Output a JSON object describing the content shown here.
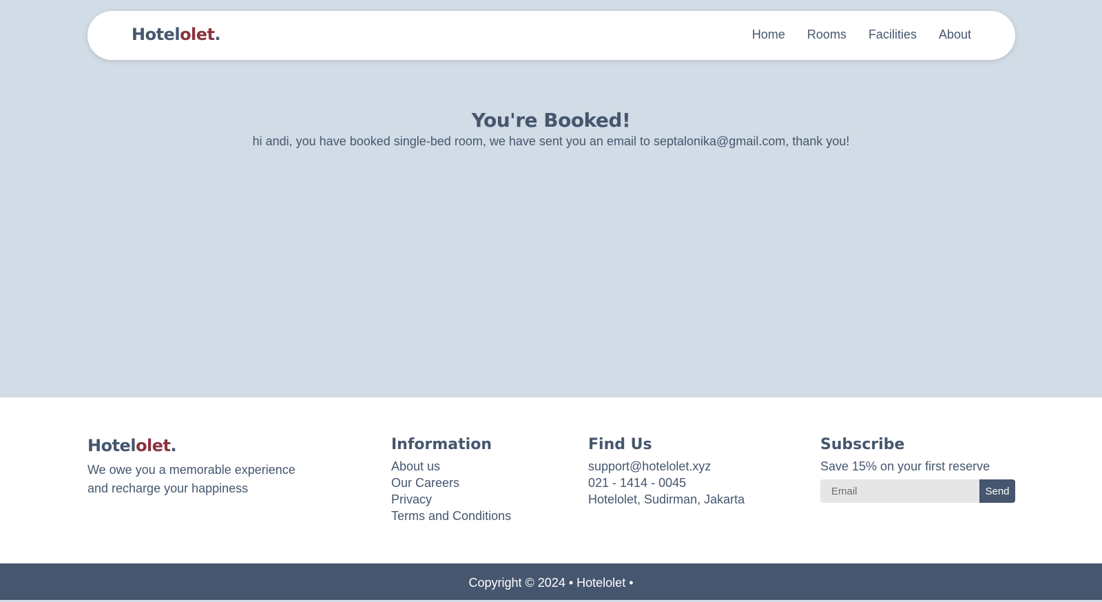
{
  "brand": {
    "name_main": "Hotel",
    "name_accent": "olet",
    "name_dot": ".",
    "colors": {
      "primary": "#45566e",
      "accent": "#8b3340",
      "page_bg": "#d2dce6"
    }
  },
  "nav": {
    "links": [
      "Home",
      "Rooms",
      "Facilities",
      "About"
    ]
  },
  "hero": {
    "title": "You're Booked!",
    "message": "hi andi, you have booked single-bed room, we have sent you an email to septalonika@gmail.com, thank you!"
  },
  "footer": {
    "tagline_line1": "We owe you a memorable experience",
    "tagline_line2": "and recharge your happiness",
    "information": {
      "heading": "Information",
      "links": [
        "About us",
        "Our Careers",
        "Privacy",
        "Terms and Conditions"
      ]
    },
    "find_us": {
      "heading": "Find Us",
      "email": "support@hotelolet.xyz",
      "phone": "021 - 1414 - 0045",
      "address": "Hotelolet, Sudirman, Jakarta"
    },
    "subscribe": {
      "heading": "Subscribe",
      "text": "Save 15% on your first reserve",
      "email_placeholder": "Email",
      "button_label": "Send"
    }
  },
  "copyright": "Copyright © 2024 • Hotelolet •"
}
